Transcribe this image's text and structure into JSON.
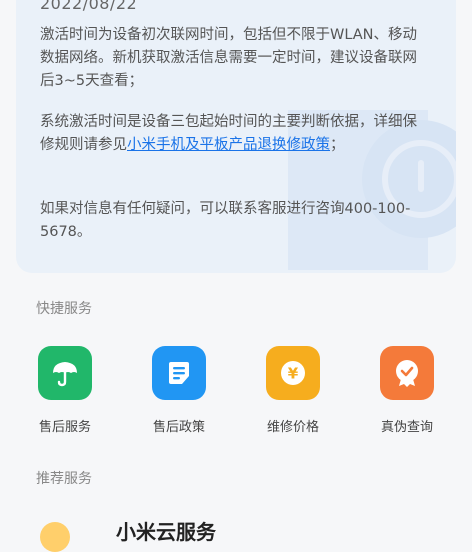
{
  "info": {
    "date": "2022/08/22",
    "para1": "激活时间为设备初次联网时间，包括但不限于WLAN、移动数据网络。新机获取激活信息需要一定时间，建议设备联网后3~5天查看；",
    "para2_prefix": "系统激活时间是设备三包起始时间的主要判断依据，详细保修规则请参见",
    "para2_link": "小米手机及平板产品退换修政策",
    "para2_suffix": "；",
    "para3": "如果对信息有任何疑问，可以联系客服进行咨询400-100-5678。"
  },
  "quick_services": {
    "title": "快捷服务",
    "items": [
      {
        "label": "售后服务",
        "icon": "umbrella-icon",
        "color": "#21b76a"
      },
      {
        "label": "售后政策",
        "icon": "document-icon",
        "color": "#2196f3"
      },
      {
        "label": "维修价格",
        "icon": "yen-coin-icon",
        "color": "#f6ad1e"
      },
      {
        "label": "真伪查询",
        "icon": "verified-badge-icon",
        "color": "#f47a3a"
      }
    ]
  },
  "recommended": {
    "title": "推荐服务",
    "first_item": "小米云服务"
  }
}
